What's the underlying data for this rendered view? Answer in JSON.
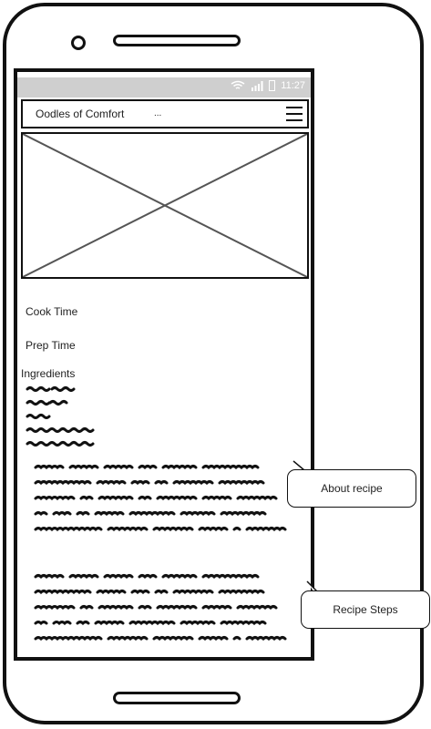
{
  "status_bar": {
    "time": "11:27"
  },
  "app_bar": {
    "title": "Oodles of Comfort",
    "overflow": "..."
  },
  "recipe": {
    "cook_time_label": "Cook Time",
    "prep_time_label": "Prep Time",
    "ingredients_label": "Ingredients"
  },
  "annotations": {
    "about_recipe": "About recipe",
    "recipe_steps": "Recipe Steps"
  },
  "icons": [
    "wifi-icon",
    "signal-icon",
    "battery-icon",
    "menu-icon",
    "image-placeholder-icon"
  ]
}
